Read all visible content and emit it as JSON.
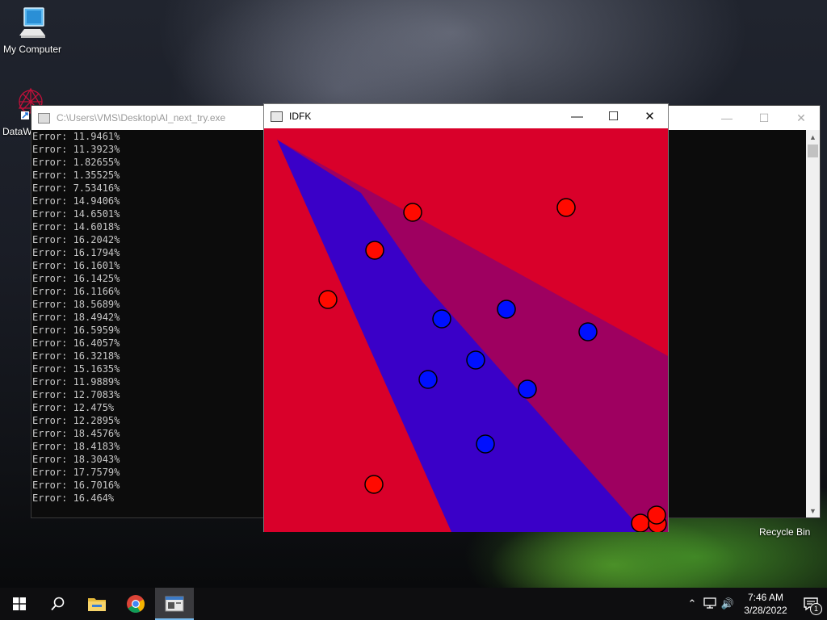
{
  "desktop": {
    "icons": {
      "my_computer": "My Computer",
      "dataw": "DataW",
      "recycle_bin": "Recycle Bin"
    }
  },
  "console_window": {
    "title": "C:\\Users\\VMS\\Desktop\\AI_next_try.exe",
    "lines": [
      "Error: 11.9461%",
      "Error: 11.3923%",
      "Error: 1.82655%",
      "Error: 1.35525%",
      "Error: 7.53416%",
      "Error: 14.9406%",
      "Error: 14.6501%",
      "Error: 14.6018%",
      "Error: 16.2042%",
      "Error: 16.1794%",
      "Error: 16.1601%",
      "Error: 16.1425%",
      "Error: 16.1166%",
      "Error: 18.5689%",
      "Error: 18.4942%",
      "Error: 16.5959%",
      "Error: 16.4057%",
      "Error: 16.3218%",
      "Error: 15.1635%",
      "Error: 11.9889%",
      "Error: 12.7083%",
      "Error: 12.475%",
      "Error: 12.2895%",
      "Error: 18.4576%",
      "Error: 18.4183%",
      "Error: 18.3043%",
      "Error: 17.7579%",
      "Error: 16.7016%",
      "Error: 16.464%"
    ]
  },
  "idfk_window": {
    "title": "IDFK",
    "colors": {
      "red_region": "#d9002a",
      "blue_region": "#3a00c8",
      "mixed_region": "#9e0060",
      "red_point": "#ff0a00",
      "blue_point": "#0010ff",
      "point_outline": "#000000"
    }
  },
  "taskbar": {
    "apps": [
      "start-icon",
      "search-icon",
      "file-explorer-icon",
      "chrome-icon",
      "console-app-icon"
    ],
    "clock": {
      "time": "7:46 AM",
      "date": "3/28/2022"
    },
    "notification_count": "1"
  }
}
